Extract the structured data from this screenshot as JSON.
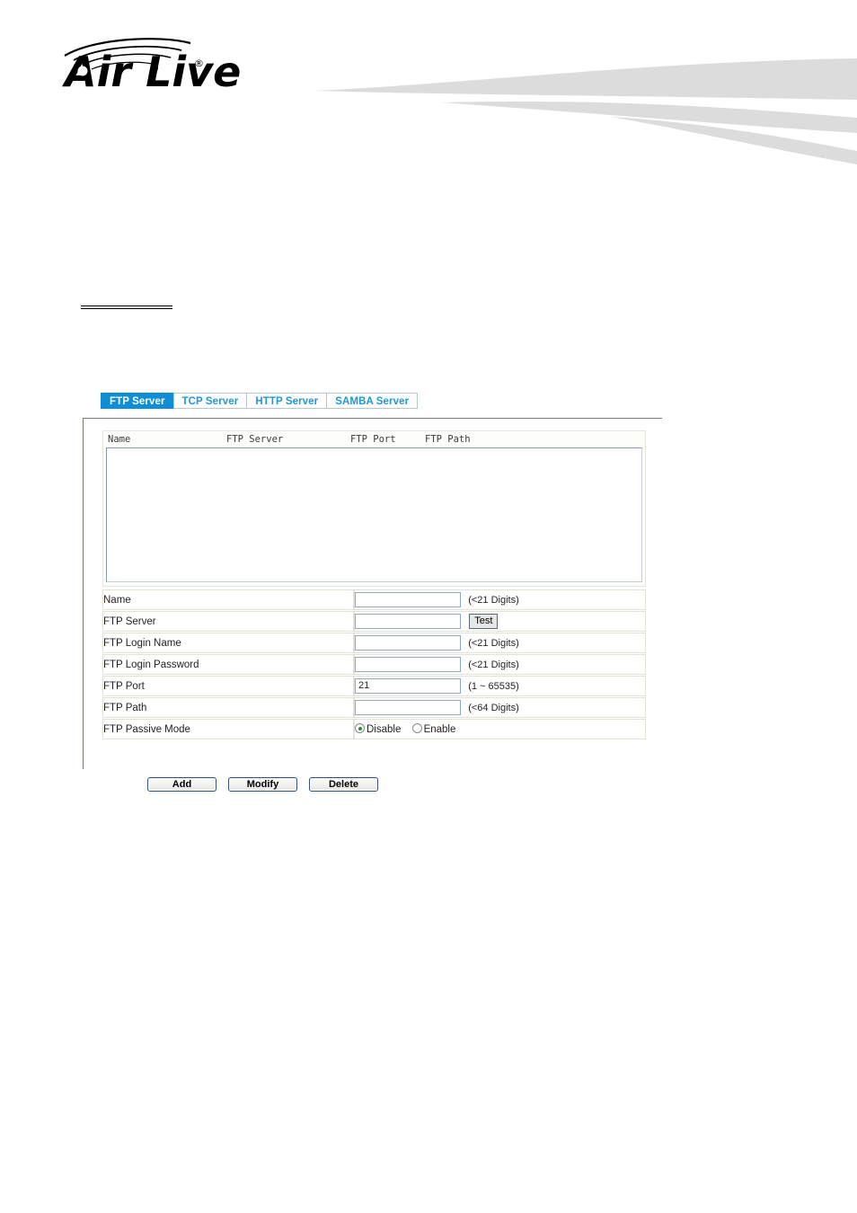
{
  "header": {
    "brand_name": "Air Live",
    "brand_mark": "registered-trademark",
    "logo_icon": "airlive-wifi-waves-logo",
    "banner_icon": "gray-swoosh-ribbon"
  },
  "section": {
    "heading": ""
  },
  "tabs": [
    {
      "label": "FTP Server",
      "active": true,
      "name": "tab-ftp-server"
    },
    {
      "label": "TCP Server",
      "active": false,
      "name": "tab-tcp-server"
    },
    {
      "label": "HTTP Server",
      "active": false,
      "name": "tab-http-server"
    },
    {
      "label": "SAMBA Server",
      "active": false,
      "name": "tab-samba-server"
    }
  ],
  "list": {
    "columns": [
      "Name",
      "FTP Server",
      "FTP Port",
      "FTP Path"
    ],
    "rows": []
  },
  "form": {
    "rows": [
      {
        "label": "Name",
        "value": "",
        "hint": "(<21 Digits)",
        "type": "text"
      },
      {
        "label": "FTP Server",
        "value": "",
        "hint": "",
        "type": "text-with-button",
        "button": "Test"
      },
      {
        "label": "FTP Login Name",
        "value": "",
        "hint": "(<21 Digits)",
        "type": "text"
      },
      {
        "label": "FTP Login Password",
        "value": "",
        "hint": "(<21 Digits)",
        "type": "text"
      },
      {
        "label": "FTP Port",
        "value": "21",
        "hint": "(1 ~ 65535)",
        "type": "text"
      },
      {
        "label": "FTP Path",
        "value": "",
        "hint": "(<64 Digits)",
        "type": "text"
      },
      {
        "label": "FTP Passive Mode",
        "value": "Disable",
        "hint": "",
        "type": "radio",
        "options": [
          {
            "label": "Disable",
            "checked": true
          },
          {
            "label": "Enable",
            "checked": false
          }
        ]
      }
    ]
  },
  "buttons": [
    {
      "label": "Add",
      "name": "add-button"
    },
    {
      "label": "Modify",
      "name": "modify-button"
    },
    {
      "label": "Delete",
      "name": "delete-button"
    }
  ],
  "colors": {
    "tab_active_bg": "#0d8ed6",
    "tab_text": "#2196d6",
    "banner_gray": "#dcdcdc",
    "input_border": "#8fa8c8",
    "radio_dot": "#2f8a2f"
  }
}
